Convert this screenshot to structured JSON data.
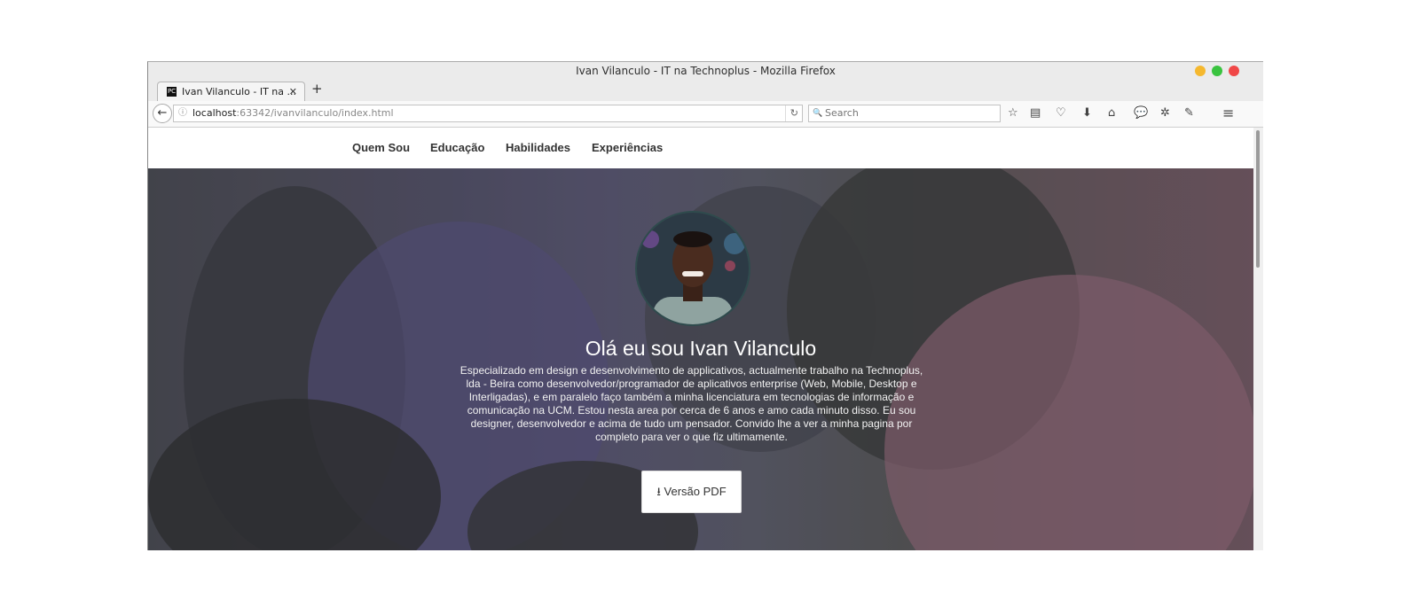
{
  "window": {
    "title": "Ivan Vilanculo - IT na Technoplus - Mozilla Firefox",
    "traffic_colors": [
      "#f5b82e",
      "#39c33f",
      "#f04747"
    ]
  },
  "tabs": [
    {
      "title": "Ivan Vilanculo - IT na ...",
      "close": "✕",
      "favicon": "PC"
    }
  ],
  "new_tab_icon": "+",
  "navbar": {
    "back_icon": "←",
    "info_icon": "ⓘ",
    "url_host": "localhost",
    "url_path": ":63342/ivanvilanculo/index.html",
    "reload_icon": "↻",
    "search_icon": "🔍",
    "search_placeholder": "Search",
    "toolbar_icons": [
      "☆",
      "▤",
      "♡",
      "⬇",
      "⌂",
      "💬",
      "✲",
      "✎",
      "≡"
    ]
  },
  "site": {
    "nav": [
      "Quem Sou",
      "Educação",
      "Habilidades",
      "Experiências"
    ],
    "hero": {
      "title": "Olá eu sou Ivan Vilanculo",
      "text": "Especializado em design e desenvolvimento de applicativos, actualmente trabalho na Technoplus, lda - Beira como desenvolvedor/programador de aplicativos enterprise (Web, Mobile, Desktop e Interligadas), e em paralelo faço também a minha licenciatura em tecnologias de informação e comunicação na UCM. Estou nesta area por cerca de 6 anos e amo cada minuto disso. Eu sou designer, desenvolvedor e acima de tudo um pensador. Convido lhe a ver a minha pagina por completo para ver o que fiz ultimamente.",
      "pdf_icon": "⭳",
      "pdf_label": "Versão PDF"
    }
  }
}
